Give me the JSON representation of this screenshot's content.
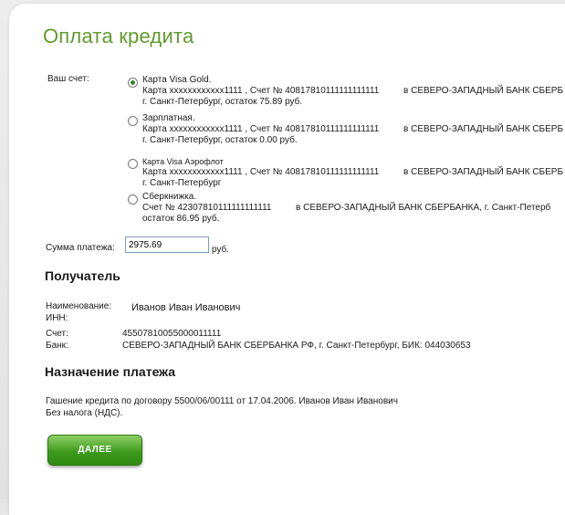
{
  "page": {
    "title": "Оплата кредита"
  },
  "account": {
    "label": "Ваш счет:",
    "options": [
      {
        "name": "Карта Visa Gold.",
        "line1": "Карта xxxxxxxxxxxx1111 , Счет № 40817810111111111111",
        "bank": "в СЕВЕРО-ЗАПАДНЫЙ БАНК СБЕРБ",
        "line2": "г. Санкт-Петербург, остаток 75.89 руб.",
        "selected": true
      },
      {
        "name": "Зарплатная.",
        "line1": "Карта xxxxxxxxxxxx1111 , Счет № 40817810111111111111",
        "bank": "в СЕВЕРО-ЗАПАДНЫЙ БАНК СБЕРБ",
        "line2": "г. Санкт-Петербург, остаток 0.00 руб.",
        "selected": false
      },
      {
        "name": "Карта Visa Аэрофлот",
        "line1": "Карта xxxxxxxxxxxx1111 , Счет № 40817810111111111111",
        "bank": "в СЕВЕРО-ЗАПАДНЫЙ БАНК СБЕРБ",
        "line2": "г. Санкт-Петербург",
        "selected": false
      },
      {
        "name": "Сберкнижка.",
        "line1": "Счет № 42307810111111111111",
        "bank": "в СЕВЕРО-ЗАПАДНЫЙ БАНК СБЕРБАНКА, г. Санкт-Петерб",
        "line2": "остаток 86.95 руб.",
        "selected": false
      }
    ]
  },
  "payment": {
    "sum_label": "Сумма платежа:",
    "sum_value": "2975.69",
    "unit": "руб."
  },
  "recipient": {
    "heading": "Получатель",
    "name_label": "Наименование:",
    "name_value": "Иванов Иван Иванович",
    "inn_label": "ИНН:",
    "account_label": "Счет:",
    "account_value": "45507810055000011111",
    "bank_label": "Банк:",
    "bank_value": "СЕВЕРО-ЗАПАДНЫЙ БАНК СБЕРБАНКА РФ, г. Санкт-Петербург, БИК: 044030653"
  },
  "purpose": {
    "heading": "Назначение платежа",
    "line1": "Гашение кредита по договору 5500/06/00111  от 17.04.2006. Иванов Иван Иванович",
    "line2": "Без налога (НДС)."
  },
  "actions": {
    "next_label": "ДАЛЕЕ"
  }
}
